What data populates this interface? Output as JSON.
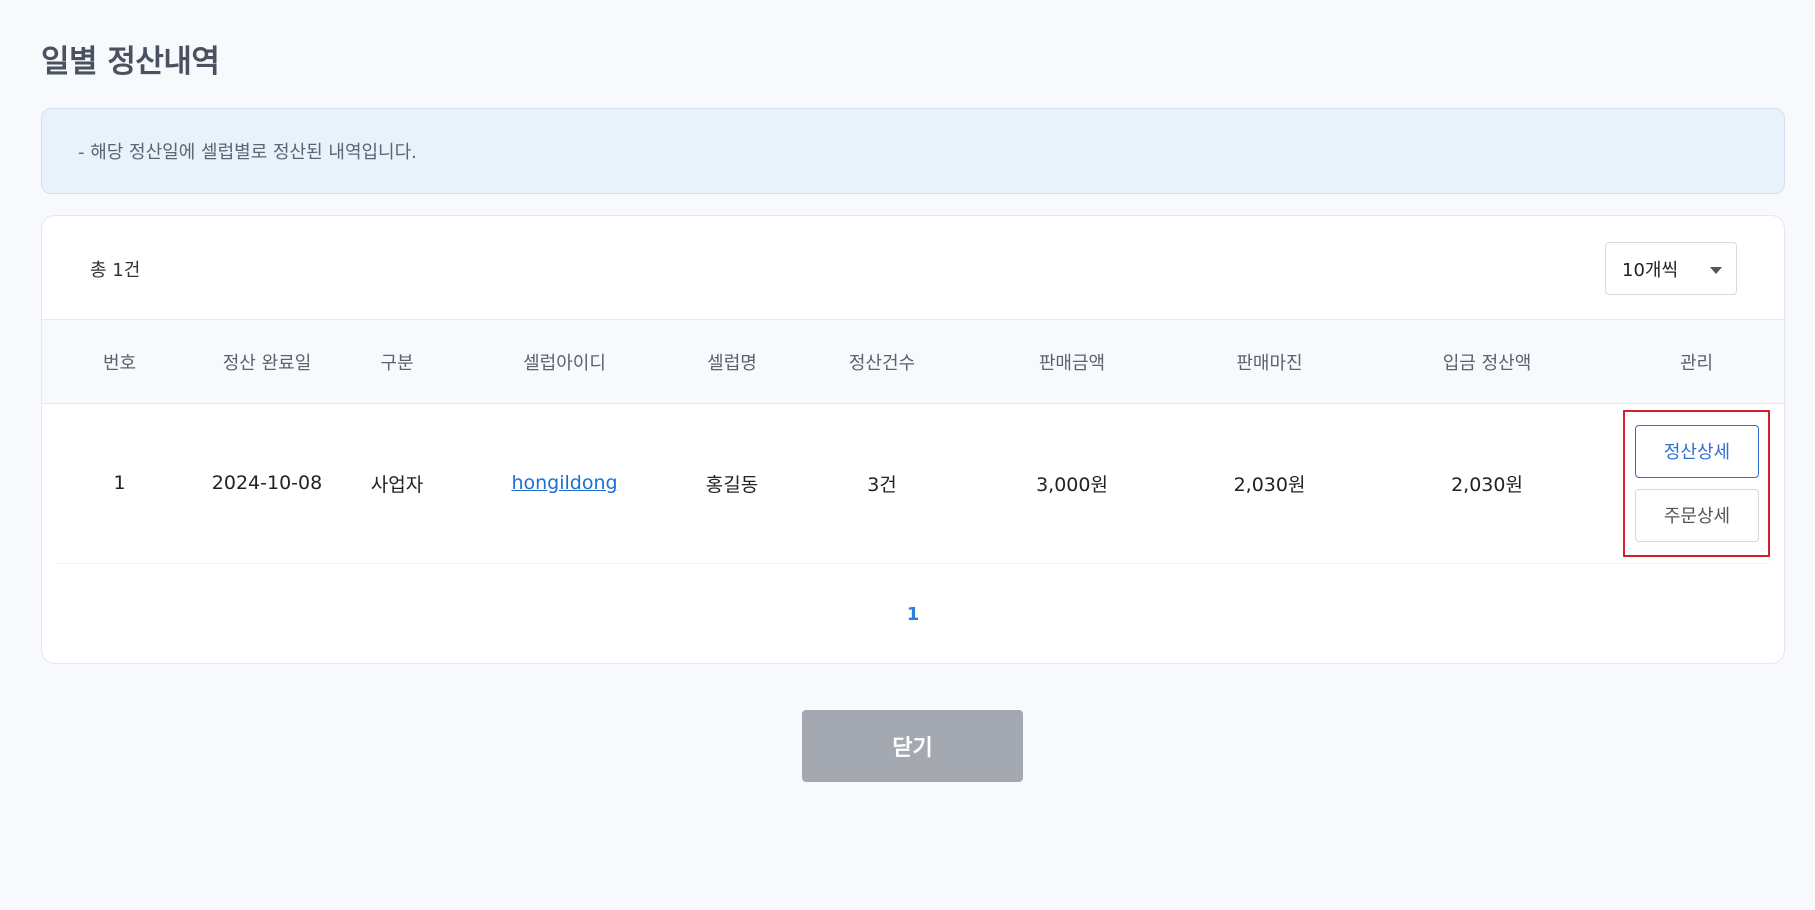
{
  "page": {
    "title": "일별 정산내역",
    "notice": "-  해당 정산일에 셀럽별로 정산된 내역입니다."
  },
  "list": {
    "total_label": "총 1건",
    "page_size_selected": "10개씩",
    "columns": [
      "번호",
      "정산 완료일",
      "구분",
      "셀럽아이디",
      "셀럽명",
      "정산건수",
      "판매금액",
      "판매마진",
      "입금 정산액",
      "관리"
    ],
    "rows": [
      {
        "no": "1",
        "completed_date": "2024-10-08",
        "type": "사업자",
        "celeb_id": "hongildong",
        "celeb_name": "홍길동",
        "count": "3건",
        "sales_amount": "3,000원",
        "sales_margin": "2,030원",
        "deposit_amount": "2,030원",
        "actions": {
          "settlement_detail": "정산상세",
          "order_detail": "주문상세"
        }
      }
    ],
    "pagination": {
      "current_page": "1"
    }
  },
  "footer": {
    "close_label": "닫기"
  },
  "colors": {
    "accent": "#2f6fd1",
    "highlight_border": "#d3202a",
    "close_button_bg": "#a3a8b1"
  }
}
